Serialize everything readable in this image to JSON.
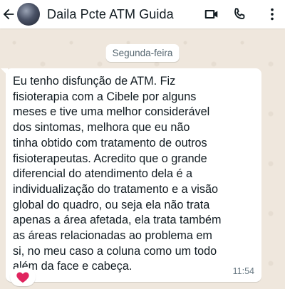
{
  "header": {
    "contact_name": "Daila Pcte ATM Guida",
    "back_icon": "arrow-left-icon",
    "video_icon": "video-camera-icon",
    "phone_icon": "phone-icon",
    "menu_icon": "more-vertical-icon"
  },
  "chat": {
    "day_label": "Segunda-feira",
    "messages": [
      {
        "text": "Eu tenho disfunção de ATM. Fiz\nfisioterapia com a Cibele por alguns\nmeses e tive uma melhor considerável\ndos sintomas, melhora que eu não\ntinha obtido com tratamento de outros\nfisioterapeutas. Acredito que o grande\ndiferencial do atendimento dela é a\nindividualização do tratamento e a visão\nglobal do quadro, ou seja ela não trata\napenas a área afetada, ela trata também\nas áreas relacionadas ao problema em\nsi,  no meu caso a coluna como um todo\nalém da face e cabeça.",
        "time": "11:54",
        "reaction": "❤️"
      }
    ]
  },
  "colors": {
    "wallpaper": "#efe7dd",
    "bubble": "#ffffff",
    "reaction_heart": "#e0245e"
  }
}
